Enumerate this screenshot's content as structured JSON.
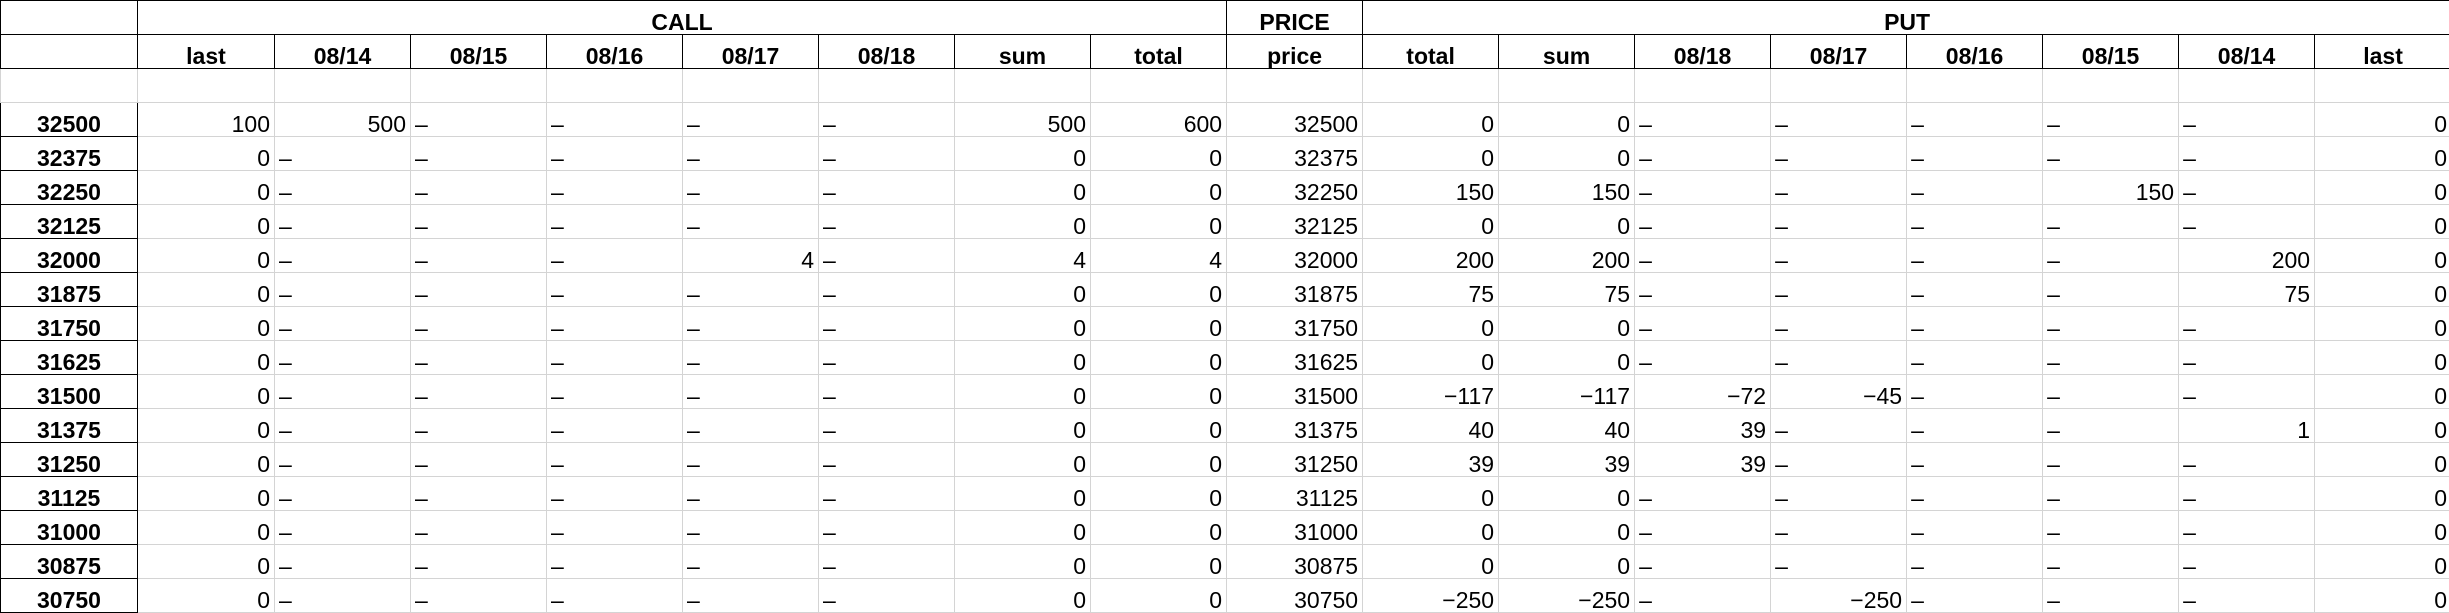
{
  "header": {
    "call": "CALL",
    "price": "PRICE",
    "put": "PUT"
  },
  "columns": [
    "",
    "last",
    "08/14",
    "08/15",
    "08/16",
    "08/17",
    "08/18",
    "sum",
    "total",
    "price",
    "total",
    "sum",
    "08/18",
    "08/17",
    "08/16",
    "08/15",
    "08/14",
    "last"
  ],
  "rows": [
    [
      "32500",
      "100",
      "500",
      "–",
      "–",
      "–",
      "–",
      "500",
      "600",
      "32500",
      "0",
      "0",
      "–",
      "–",
      "–",
      "–",
      "–",
      "0"
    ],
    [
      "32375",
      "0",
      "–",
      "–",
      "–",
      "–",
      "–",
      "0",
      "0",
      "32375",
      "0",
      "0",
      "–",
      "–",
      "–",
      "–",
      "–",
      "0"
    ],
    [
      "32250",
      "0",
      "–",
      "–",
      "–",
      "–",
      "–",
      "0",
      "0",
      "32250",
      "150",
      "150",
      "–",
      "–",
      "–",
      "150",
      "–",
      "0"
    ],
    [
      "32125",
      "0",
      "–",
      "–",
      "–",
      "–",
      "–",
      "0",
      "0",
      "32125",
      "0",
      "0",
      "–",
      "–",
      "–",
      "–",
      "–",
      "0"
    ],
    [
      "32000",
      "0",
      "–",
      "–",
      "–",
      "4",
      "–",
      "4",
      "4",
      "32000",
      "200",
      "200",
      "–",
      "–",
      "–",
      "–",
      "200",
      "0"
    ],
    [
      "31875",
      "0",
      "–",
      "–",
      "–",
      "–",
      "–",
      "0",
      "0",
      "31875",
      "75",
      "75",
      "–",
      "–",
      "–",
      "–",
      "75",
      "0"
    ],
    [
      "31750",
      "0",
      "–",
      "–",
      "–",
      "–",
      "–",
      "0",
      "0",
      "31750",
      "0",
      "0",
      "–",
      "–",
      "–",
      "–",
      "–",
      "0"
    ],
    [
      "31625",
      "0",
      "–",
      "–",
      "–",
      "–",
      "–",
      "0",
      "0",
      "31625",
      "0",
      "0",
      "–",
      "–",
      "–",
      "–",
      "–",
      "0"
    ],
    [
      "31500",
      "0",
      "–",
      "–",
      "–",
      "–",
      "–",
      "0",
      "0",
      "31500",
      "−117",
      "−117",
      "−72",
      "−45",
      "–",
      "–",
      "–",
      "0"
    ],
    [
      "31375",
      "0",
      "–",
      "–",
      "–",
      "–",
      "–",
      "0",
      "0",
      "31375",
      "40",
      "40",
      "39",
      "–",
      "–",
      "–",
      "1",
      "0"
    ],
    [
      "31250",
      "0",
      "–",
      "–",
      "–",
      "–",
      "–",
      "0",
      "0",
      "31250",
      "39",
      "39",
      "39",
      "–",
      "–",
      "–",
      "–",
      "0"
    ],
    [
      "31125",
      "0",
      "–",
      "–",
      "–",
      "–",
      "–",
      "0",
      "0",
      "31125",
      "0",
      "0",
      "–",
      "–",
      "–",
      "–",
      "–",
      "0"
    ],
    [
      "31000",
      "0",
      "–",
      "–",
      "–",
      "–",
      "–",
      "0",
      "0",
      "31000",
      "0",
      "0",
      "–",
      "–",
      "–",
      "–",
      "–",
      "0"
    ],
    [
      "30875",
      "0",
      "–",
      "–",
      "–",
      "–",
      "–",
      "0",
      "0",
      "30875",
      "0",
      "0",
      "–",
      "–",
      "–",
      "–",
      "–",
      "0"
    ],
    [
      "30750",
      "0",
      "–",
      "–",
      "–",
      "–",
      "–",
      "0",
      "0",
      "30750",
      "−250",
      "−250",
      "–",
      "−250",
      "–",
      "–",
      "–",
      "0"
    ]
  ]
}
